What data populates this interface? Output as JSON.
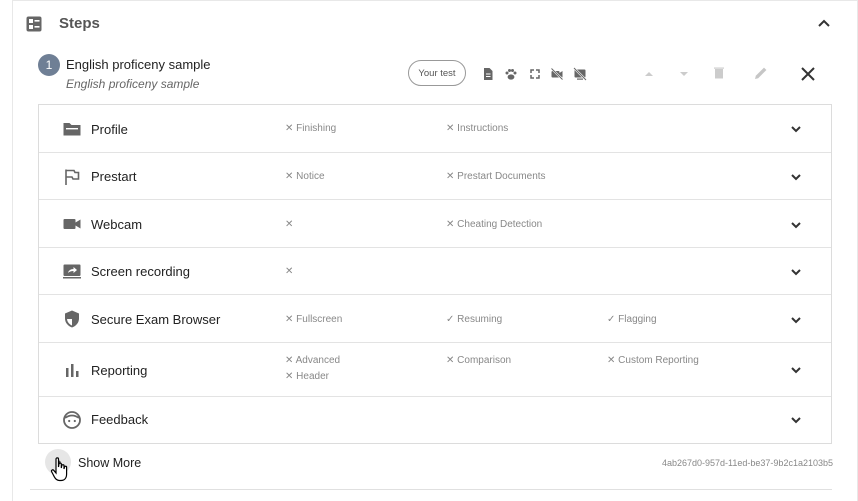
{
  "section": {
    "title": "Steps"
  },
  "step": {
    "number": "1",
    "title": "English proficeny sample",
    "subtitle": "English proficeny sample",
    "your_test_label": "Your test"
  },
  "rows": [
    {
      "label": "Profile",
      "icon": "folder-icon",
      "tags": [
        {
          "mark": "✕",
          "text": "Finishing"
        },
        {
          "mark": "✕",
          "text": "Instructions"
        }
      ]
    },
    {
      "label": "Prestart",
      "icon": "flag-icon",
      "tags": [
        {
          "mark": "✕",
          "text": "Notice"
        },
        {
          "mark": "✕",
          "text": "Prestart Documents"
        }
      ]
    },
    {
      "label": "Webcam",
      "icon": "videocam-icon",
      "tags": [
        {
          "mark": "✕",
          "text": ""
        },
        {
          "mark": "✕",
          "text": "Cheating Detection"
        }
      ]
    },
    {
      "label": "Screen recording",
      "icon": "screen-share-icon",
      "tags": [
        {
          "mark": "✕",
          "text": ""
        }
      ]
    },
    {
      "label": "Secure Exam Browser",
      "icon": "shield-icon",
      "tags": [
        {
          "mark": "✕",
          "text": "Fullscreen"
        },
        {
          "mark": "✓",
          "text": "Resuming"
        },
        {
          "mark": "✓",
          "text": "Flagging"
        }
      ]
    },
    {
      "label": "Reporting",
      "icon": "bar-chart-icon",
      "tags": [
        {
          "mark": "✕",
          "text": "Advanced"
        },
        {
          "mark": "✕",
          "text": "Comparison"
        },
        {
          "mark": "✕",
          "text": "Custom Reporting"
        },
        {
          "mark": "✕",
          "text": "Header"
        }
      ]
    },
    {
      "label": "Feedback",
      "icon": "face-icon",
      "tags": []
    }
  ],
  "footer": {
    "show_more_label": "Show More",
    "uuid": "4ab267d0-957d-11ed-be37-9b2c1a2103b5"
  },
  "colors": {
    "step_badge": "#6f7f95",
    "icon": "#666666",
    "tag_text": "#888888"
  }
}
